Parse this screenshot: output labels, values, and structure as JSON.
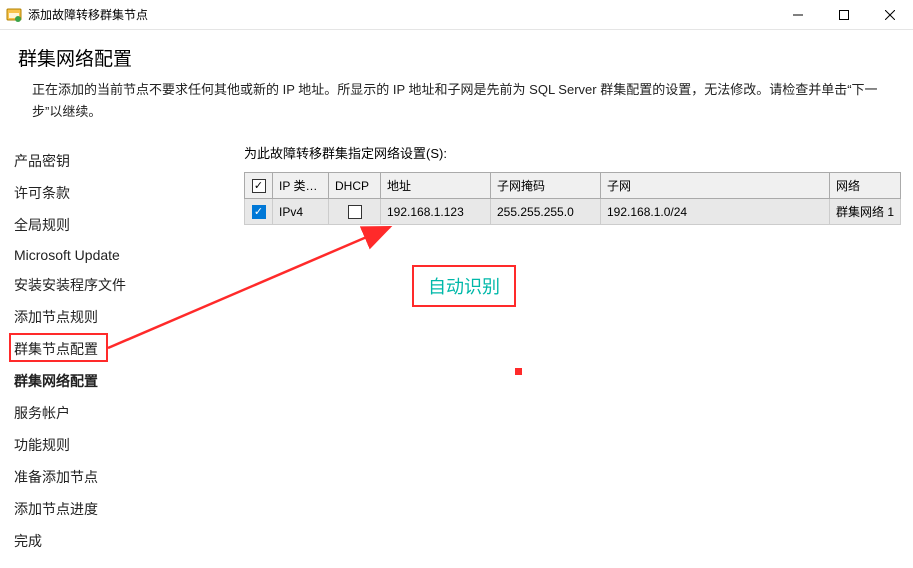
{
  "window": {
    "title": "添加故障转移群集节点"
  },
  "header": {
    "title": "群集网络配置",
    "desc": "正在添加的当前节点不要求任何其他或新的 IP 地址。所显示的 IP 地址和子网是先前为 SQL Server 群集配置的设置，无法修改。请检查并单击“下一步”以继续。"
  },
  "sidebar": {
    "items": [
      "产品密钥",
      "许可条款",
      "全局规则",
      "Microsoft Update",
      "安装安装程序文件",
      "添加节点规则",
      "群集节点配置",
      "群集网络配置",
      "服务帐户",
      "功能规则",
      "准备添加节点",
      "添加节点进度",
      "完成"
    ],
    "active_index": 7
  },
  "section_label": "为此故障转移群集指定网络设置(S):",
  "table": {
    "headers": [
      "",
      "IP 类…",
      "DHCP",
      "地址",
      "子网掩码",
      "子网",
      "网络"
    ],
    "row": {
      "checked": true,
      "ip_type": "IPv4",
      "dhcp_checked": false,
      "address": "192.168.1.123",
      "mask": "255.255.255.0",
      "subnet": "192.168.1.0/24",
      "network": "群集网络 1"
    }
  },
  "annotation": {
    "label": "自动识别"
  }
}
